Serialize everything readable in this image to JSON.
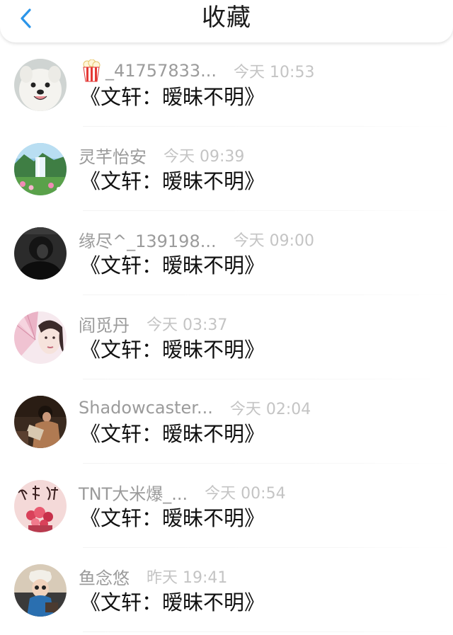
{
  "header": {
    "title": "收藏",
    "back_icon": "chevron-left-icon",
    "accent_color": "#2b95e9"
  },
  "items": [
    {
      "username": "_41757833...",
      "has_emoji": true,
      "emoji_icon": "popcorn-icon",
      "time": "今天 10:53",
      "content": "《文轩：暧昧不明》",
      "avatar": "white-dog"
    },
    {
      "username": "灵芊怡安",
      "time": "今天 09:39",
      "content": "《文轩：暧昧不明》",
      "avatar": "waterfall-landscape"
    },
    {
      "username": "缘尽^_139198...",
      "time": "今天 09:00",
      "content": "《文轩：暧昧不明》",
      "avatar": "dark-portrait"
    },
    {
      "username": "阎觅丹",
      "time": "今天 03:37",
      "content": "《文轩：暧昧不明》",
      "avatar": "woman-with-fan"
    },
    {
      "username": "Shadowcaster...",
      "time": "今天 02:04",
      "content": "《文轩：暧昧不明》",
      "avatar": "person-reading"
    },
    {
      "username": "TNT大米爆_...",
      "time": "今天 00:54",
      "content": "《文轩：暧昧不明》",
      "avatar": "calligraphy-flowers"
    },
    {
      "username": "鱼念悠",
      "time": "昨天 19:41",
      "content": "《文轩：暧昧不明》",
      "avatar": "cartoon-girl"
    }
  ]
}
